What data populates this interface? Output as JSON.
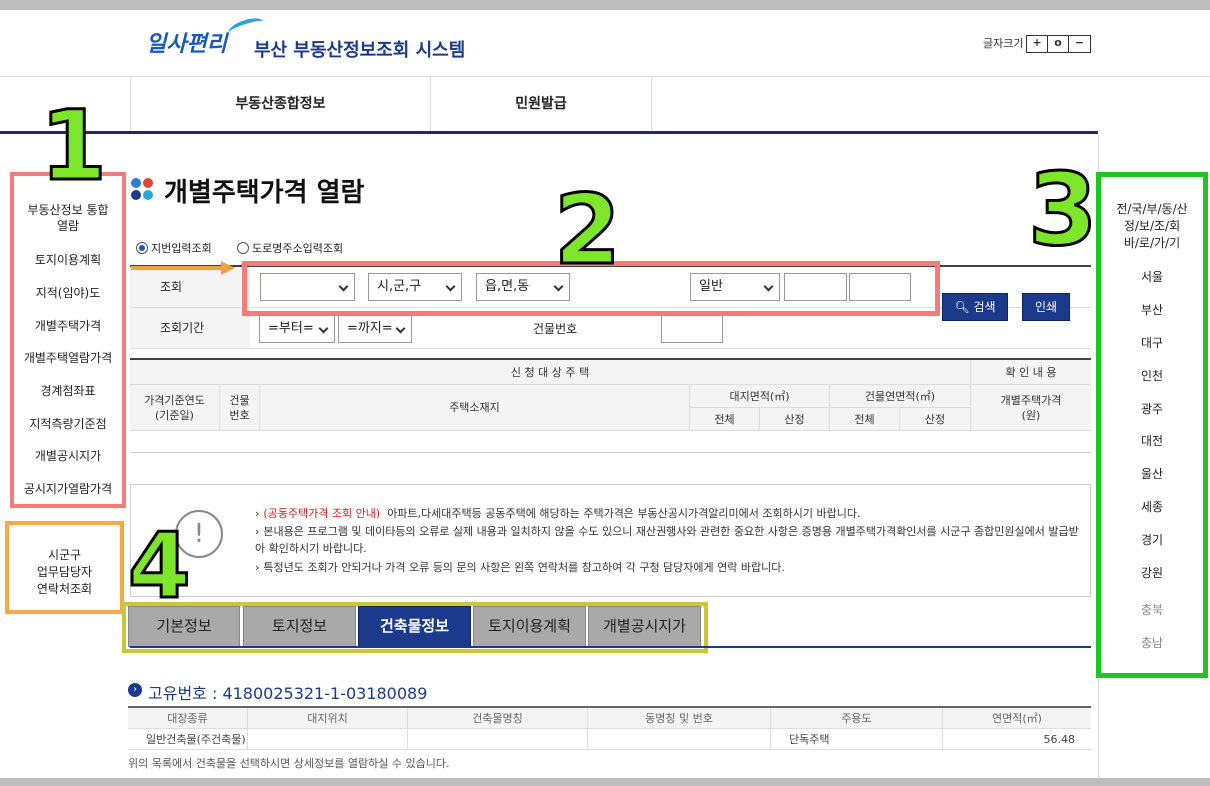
{
  "header": {
    "logo_text": "일사편리",
    "system_title": "부산 부동산정보조회 시스템",
    "font_size_label": "글자크기",
    "font_size_buttons": [
      "+",
      "o",
      "−"
    ]
  },
  "menu": [
    "부동산종합정보",
    "민원발급"
  ],
  "left_nav": {
    "items": [
      "부동산정보 통합\n열람",
      "토지이용계획",
      "지적(임야)도",
      "개별주택가격",
      "개별주택열람가격",
      "경계점좌표",
      "지적측량기준점",
      "개별공시지가",
      "공시지가열람가격"
    ]
  },
  "contact_box": [
    "시군구",
    "업무담당자",
    "연락처조회"
  ],
  "annotations": [
    "1",
    "2",
    "3",
    "4"
  ],
  "page_title": "개별주택가격 열람",
  "search": {
    "radio_options": [
      "지번입력조회",
      "도로명주소입력조회"
    ],
    "row1_label": "조회",
    "row2_label": "조회기간",
    "sido_value": "",
    "sigungu_value": "시,군,구",
    "eupmyeon_value": "읍,면,동",
    "type_value": "일반",
    "from_value": "=부터=",
    "to_value": "=까지=",
    "building_no_label": "건물번호",
    "search_button": "검색",
    "print_button": "인쇄"
  },
  "results_table": {
    "group_left": "신 청 대 상 주 택",
    "group_right": "확 인 내 용",
    "col_year": "가격기준연도\n(기준일)",
    "col_building": "건물\n번호",
    "col_address": "주택소재지",
    "col_land_area": "대지면적(㎡)",
    "col_bld_area": "건물연면적(㎡)",
    "col_price": "개별주택가격\n(원)",
    "sub_total": "전체",
    "sub_calc": "산정"
  },
  "info": {
    "line1_red": "(공동주택가격 조회 안내)",
    "line1_rest": "아파트,다세대주택등 공동주택에 해당하는 주택가격은 부동산공시가격알리미에서 조회하시기 바랍니다.",
    "line2": "본내용은 프로그램 및 데이타등의 오류로 실제 내용과 일치하지 않을 수도 있으니 재산권행사와 관련한 중요한 사항은 증명용 개별주택가격확인서를 시군구 종합민원실에서 발급받아 확인하시기 바랍니다.",
    "line3": "특정년도 조회가 안되거나 가격 오류 등의 문의 사항은 왼쪽 연락처를 참고하여 각 구청 담당자에게 연락 바랍니다.",
    "icon_text": "!",
    "bullet": "›"
  },
  "tabs": [
    "기본정보",
    "토지정보",
    "건축물정보",
    "토지이용계획",
    "개별공시지가"
  ],
  "active_tab": "건축물정보",
  "unique_id": {
    "icon": "›",
    "label": "고유번호 : 4180025321-1-03180089"
  },
  "building_table": {
    "headers": [
      "대장종류",
      "대지위치",
      "건축물명칭",
      "동명칭 및 번호",
      "주용도",
      "연면적(㎡)"
    ],
    "rows": [
      [
        "일반건축물(주건축물)",
        "",
        "",
        "",
        "단독주택",
        "56.48"
      ]
    ],
    "note": "위의 목록에서 건축물을 선택하시면 상세정보를 열람하실 수 있습니다."
  },
  "right_nav": {
    "title": "전/국/부/동/산\n정/보/조/회\n바/로/가/기",
    "regions": [
      "서울",
      "부산",
      "대구",
      "인천",
      "광주",
      "대전",
      "울산",
      "세종",
      "경기",
      "강원",
      "충북",
      "충남"
    ]
  },
  "colors": {
    "navy": "#1b3a8c",
    "annotation_green": "#7ee62a",
    "left_frame": "#f47c7c",
    "right_frame": "#21c521",
    "tab_frame": "#c8c83a",
    "contact_frame": "#f7a94a"
  }
}
